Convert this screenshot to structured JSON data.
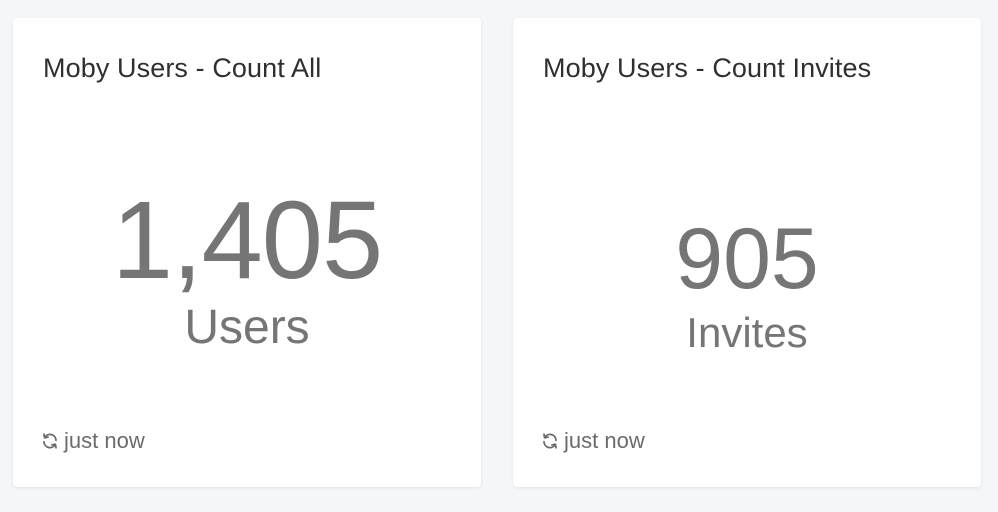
{
  "cards": [
    {
      "title": "Moby Users - Count All",
      "value": "1,405",
      "unit": "Users",
      "refresh_label": "just now",
      "refresh_icon": "refresh-icon"
    },
    {
      "title": "Moby Users - Count Invites",
      "value": "905",
      "unit": "Invites",
      "refresh_label": "just now",
      "refresh_icon": "refresh-icon"
    }
  ],
  "colors": {
    "background": "#f5f6f8",
    "card": "#ffffff",
    "title_text": "#2f2f2f",
    "metric_text": "#757575",
    "meta_text": "#6b6b6b"
  }
}
